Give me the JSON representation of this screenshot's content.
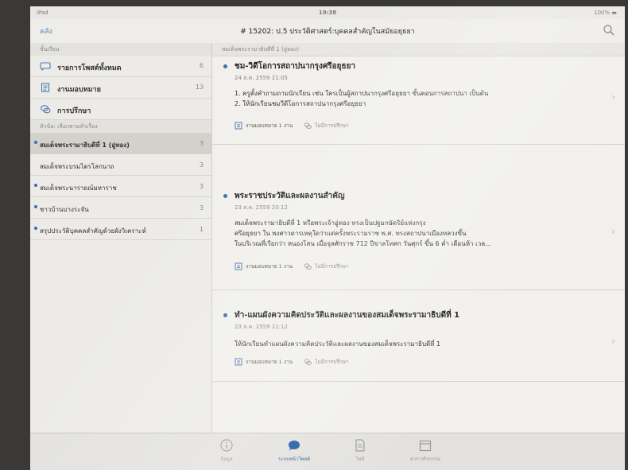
{
  "status_bar": {
    "device": "iPad",
    "time": "19:38",
    "battery": "100% ▬"
  },
  "nav": {
    "back_label": "คลัง",
    "title": "# 15202: ป.5 ประวัติศาสตร์:บุคคลสำคัญในสมัยอยุธยา"
  },
  "sidebar": {
    "section_header": "ชั้นเรียน",
    "menu": [
      {
        "label": "รายการโพสต์ทั้งหมด",
        "count": "6",
        "icon": "speech-bubble-icon"
      },
      {
        "label": "งานมอบหมาย",
        "count": "13",
        "icon": "assignment-icon"
      },
      {
        "label": "การปรึกษา",
        "count": "",
        "icon": "chat-bubbles-icon"
      }
    ],
    "topics_header": "หัวข้อ: เลือกตามหัวเรื่อง",
    "topics": [
      {
        "label": "สมเด็จพระรามาธิบดีที่ 1 (อู่ทอง)",
        "count": "3",
        "active": true
      },
      {
        "label": "สมเด็จพระบรมไตรโลกนาถ",
        "count": "3",
        "active": false
      },
      {
        "label": "สมเด็จพระนารายณ์มหาราช",
        "count": "3",
        "active": false
      },
      {
        "label": "ชาวบ้านบางระจัน",
        "count": "3",
        "active": false
      },
      {
        "label": "สรุปประวัติบุคคลสำคัญด้วยผังวิเคราะห์",
        "count": "1",
        "active": false
      }
    ]
  },
  "main": {
    "header": "สมเด็จพระรามาธิบดีที่ 1 (อู่ทอง)",
    "posts": [
      {
        "title": "ชม-วิดีโอการสถาปนากรุงศรีอยุธยา",
        "date": "24 ส.ค. 2559 21:05",
        "body": [
          "1. ครูตั้งคำถามถามนักเรียน เช่น ใครเป็นผู้สถาปนากรุงศรีอยุธยา ขั้นตอนการสถาปนา เป็นต้น",
          "2. ให้นักเรียนชมวีดีโอการสถาปนากรุงศรีอยุธยา"
        ],
        "assignment": "งานมอบหมาย 1 งาน",
        "discussion": "ไม่มีการปรึกษา"
      },
      {
        "title": "พระราชประวัติและผลงานสำคัญ",
        "date": "23 ส.ค. 2559 20:12",
        "body": [
          "สมเด็จพระรามาธิบดีที่ 1 หรือพระเจ้าอู่ทอง ทรงเป็นปฐมกษัตริย์แห่งกรุง",
          "ศรีอยุธยา ใน พงศาวดารเหตุใดว่าแต่ครั้งพระรามราช พ.ศ. ทรงสถาปนาเมืองหลวงขึ้น",
          "ในบริเวณที่เรียกว่า หนองโสน เมื่อจุลศักราช 712 ปีขาลโทศก วันศุกร์ ขึ้น 6 ค่ำ เดือนห้า เวล..."
        ],
        "assignment": "งานมอบหมาย 1 งาน",
        "discussion": "ไม่มีการปรึกษา"
      },
      {
        "title": "ทำ-แผนผังความคิดประวัติและผลงานของสมเด็จพระรามาธิบดีที่ 1",
        "date": "23 ส.ค. 2559 21:12",
        "body": [
          "ให้นักเรียนทำแผนผังความคิดประวัติและผลงานของสมเด็จพระรามาธิบดีที่ 1"
        ],
        "assignment": "งานมอบหมาย 1 งาน",
        "discussion": "ไม่มีการปรึกษา"
      }
    ]
  },
  "tabbar": {
    "tabs": [
      {
        "label": "ข้อมูล",
        "icon": "info-icon",
        "active": false
      },
      {
        "label": "ระบบหน้าโพสต์",
        "icon": "chat-bubble-icon",
        "active": true
      },
      {
        "label": "ไฟล์",
        "icon": "document-icon",
        "active": false
      },
      {
        "label": "ตารางกิจกรรม",
        "icon": "calendar-icon",
        "active": false
      }
    ]
  },
  "colors": {
    "accent": "#3b6ea8",
    "background": "#f1f0ec",
    "sidebar": "#ecebe7"
  }
}
